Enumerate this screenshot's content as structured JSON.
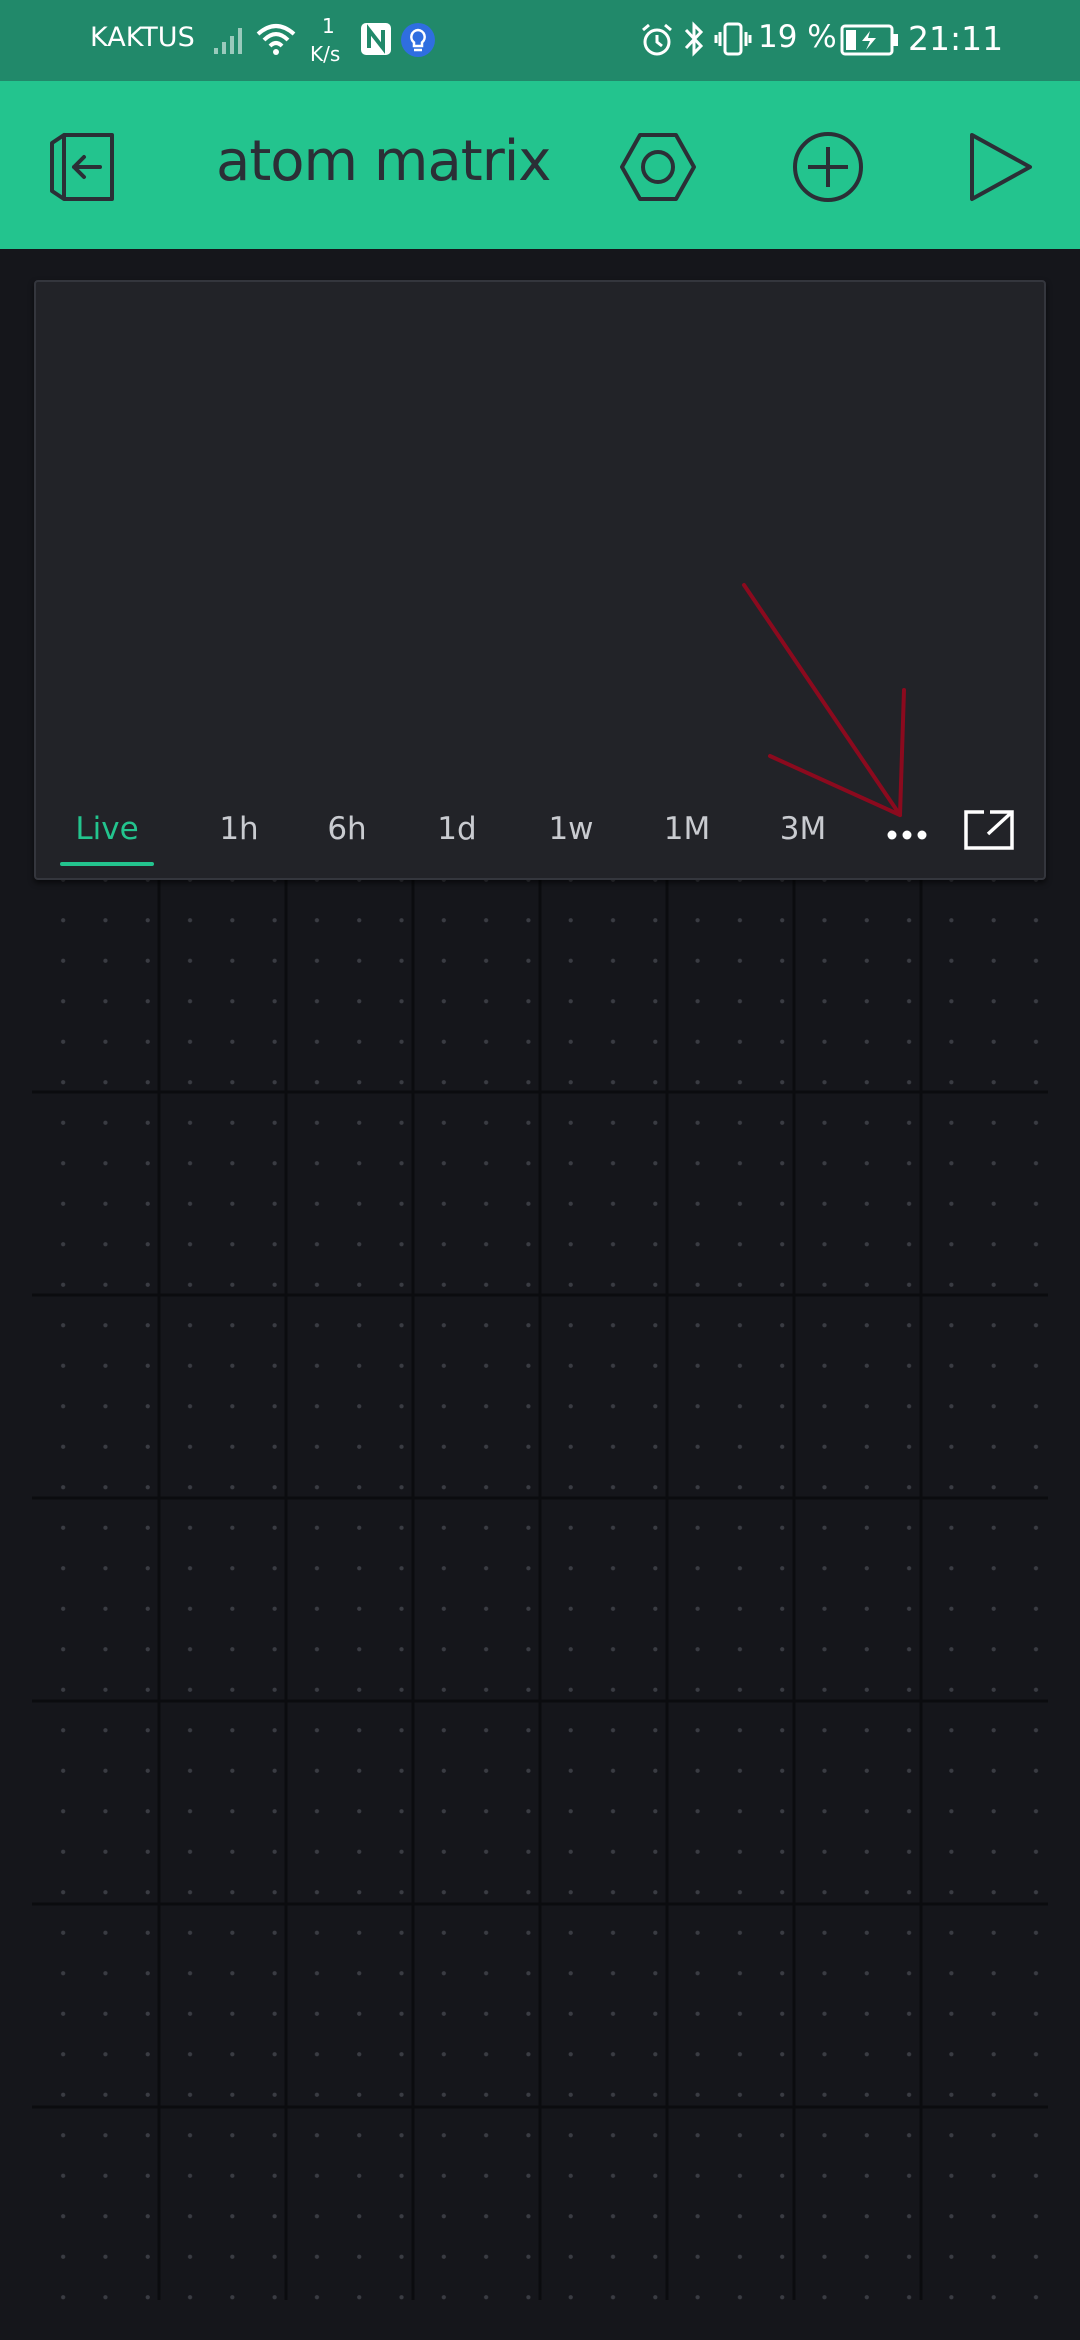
{
  "status_bar": {
    "carrier": "KAKTUS",
    "net_speed_value": "1",
    "net_speed_unit": "K/s",
    "battery_percent": "19 %",
    "time": "21:11",
    "icons": [
      "signal-icon",
      "wifi-icon",
      "nfc-icon",
      "notification-bulb-icon",
      "alarm-icon",
      "bluetooth-icon",
      "vibrate-icon",
      "battery-charging-icon"
    ]
  },
  "app_bar": {
    "title": "atom matrix",
    "left_icon": "exit-project-icon",
    "right_icons": [
      "project-settings-icon",
      "add-widget-icon",
      "play-icon"
    ]
  },
  "superchart": {
    "periods": [
      {
        "label": "Live",
        "active": true
      },
      {
        "label": "1h",
        "active": false
      },
      {
        "label": "6h",
        "active": false
      },
      {
        "label": "1d",
        "active": false
      },
      {
        "label": "1w",
        "active": false
      },
      {
        "label": "1M",
        "active": false
      },
      {
        "label": "3M",
        "active": false
      }
    ],
    "more_icon": "more-dots-icon",
    "fullscreen_icon": "fullscreen-open-icon"
  },
  "colors": {
    "status_bar": "#21896a",
    "app_bar": "#23c48e",
    "accent": "#23c48e",
    "background": "#15161b",
    "widget_bg": "#222328",
    "annotation": "#8b0a1e"
  }
}
